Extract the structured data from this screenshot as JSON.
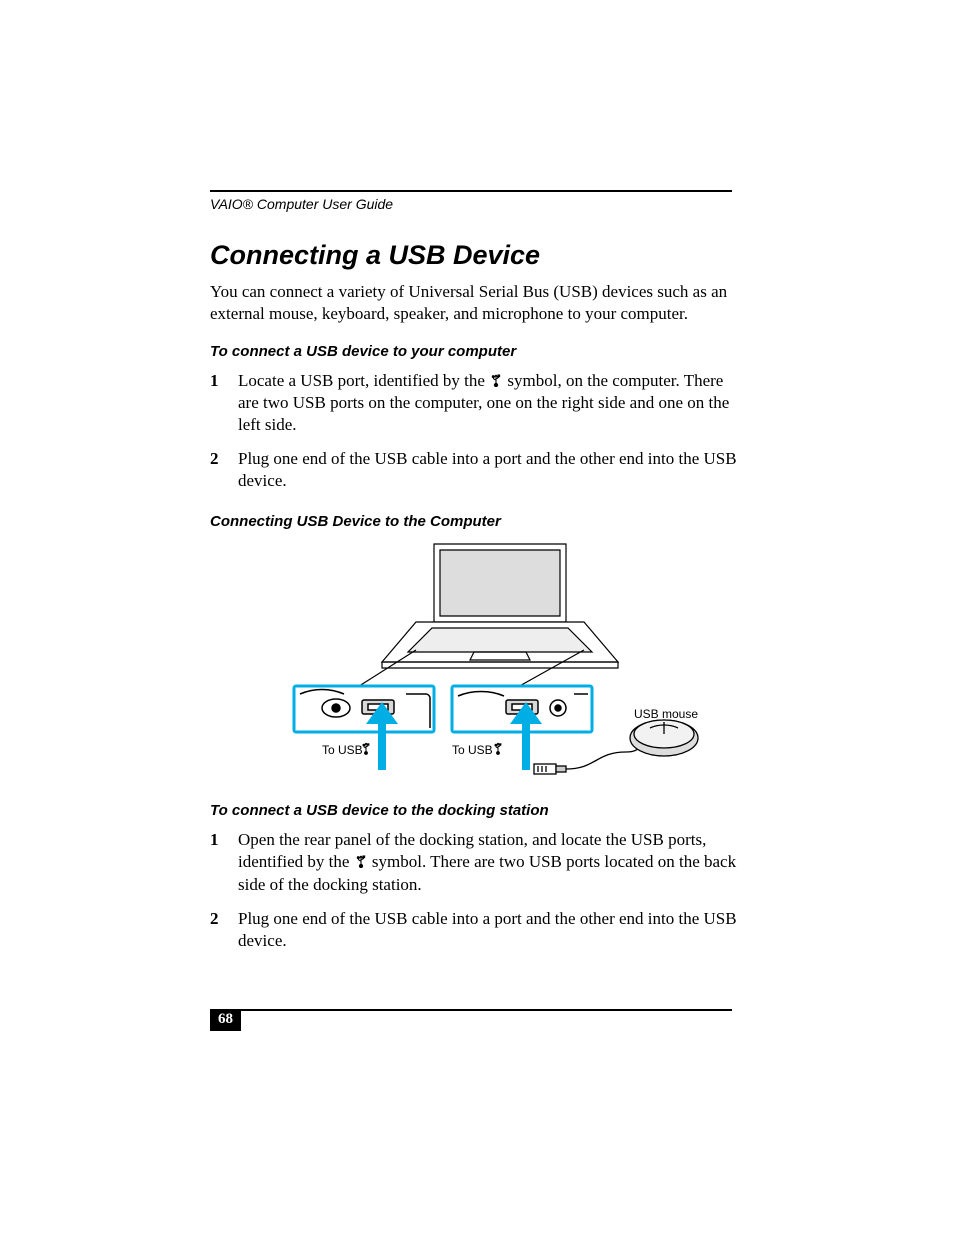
{
  "runningHead": "VAIO® Computer User Guide",
  "title": "Connecting a USB Device",
  "intro": "You can connect a variety of Universal Serial Bus (USB) devices such as an external mouse, keyboard, speaker, and microphone to your computer.",
  "sectionA": {
    "heading": "To connect a USB device to your computer",
    "steps": [
      {
        "pre": "Locate a USB port, identified by the ",
        "glyph": "usb",
        "post": " symbol, on the computer. There are two USB ports on the computer, one on the right side and one on the left side."
      },
      {
        "pre": "Plug one end of the USB cable into a port and the other end into the USB device.",
        "glyph": null,
        "post": ""
      }
    ]
  },
  "figure": {
    "caption": "Connecting USB Device to the Computer",
    "labels": {
      "toUsbLeft": "To USB",
      "toUsbRight": "To USB",
      "usbMouse": "USB mouse"
    }
  },
  "sectionB": {
    "heading": "To connect a USB device to the docking station",
    "steps": [
      {
        "pre": "Open the rear panel of the docking station, and locate the USB ports, identified by the ",
        "glyph": "usb",
        "post": " symbol. There are two USB ports located on the back side of the docking station."
      },
      {
        "pre": "Plug one end of the USB cable into a port and the other end into the USB device.",
        "glyph": null,
        "post": ""
      }
    ]
  },
  "pageNumber": "68"
}
